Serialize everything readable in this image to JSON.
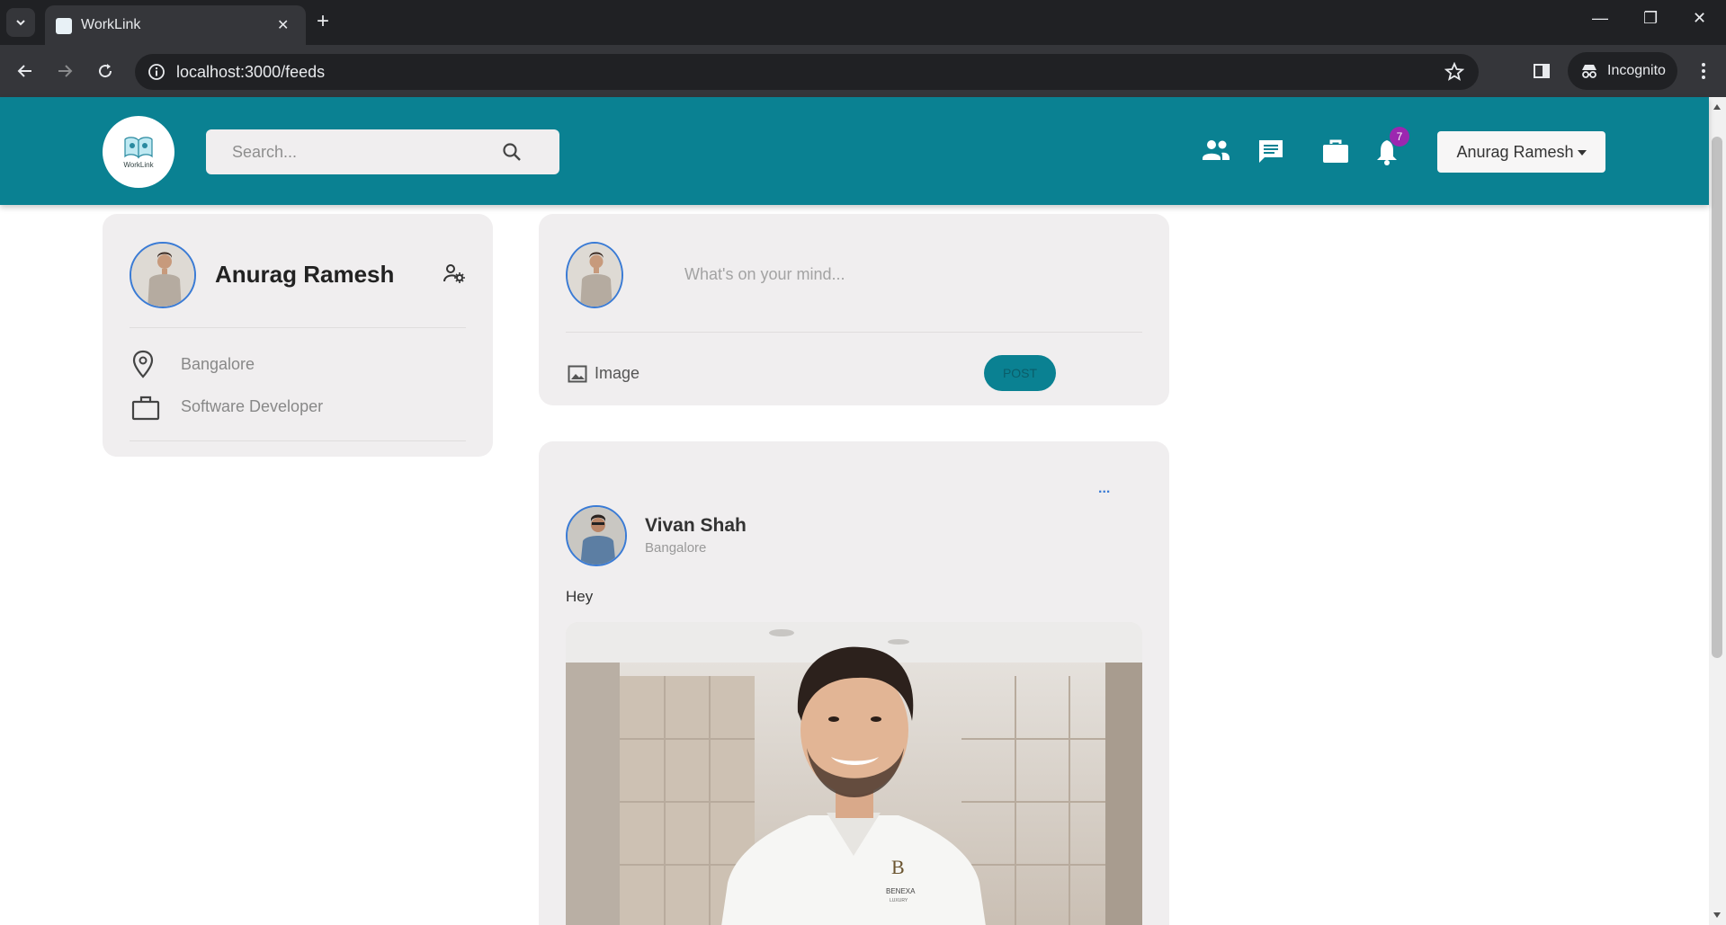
{
  "browser": {
    "tab_title": "WorkLink",
    "url": "localhost:3000/feeds",
    "incognito_label": "Incognito"
  },
  "header": {
    "logo_text": "WorkLink",
    "search_placeholder": "Search...",
    "notification_count": "7",
    "user_menu_label": "Anurag Ramesh",
    "nav_icons": [
      "people-icon",
      "chat-icon",
      "briefcase-icon",
      "bell-icon"
    ],
    "brand_color": "#0a8192"
  },
  "profile": {
    "name": "Anurag Ramesh",
    "location": "Bangalore",
    "occupation": "Software Developer"
  },
  "composer": {
    "placeholder": "What's on your mind...",
    "image_label": "Image",
    "post_label": "POST"
  },
  "post": {
    "author": "Vivan Shah",
    "location": "Bangalore",
    "text": "Hey",
    "more_label": "...",
    "image_caption_brand": "BENEXA",
    "image_caption_sub": "LUXURY"
  }
}
